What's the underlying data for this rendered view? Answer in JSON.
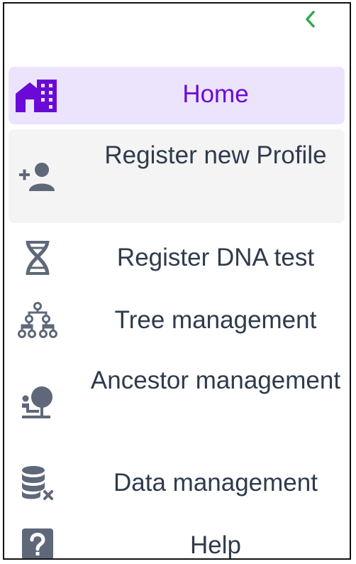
{
  "sidebar": {
    "collapse_icon": "chevron-left-icon",
    "colors": {
      "active_bg": "#ece3fc",
      "active_text": "#6a0ad6",
      "hover_bg": "#f4f4f4",
      "text": "#2f3b4c",
      "icon": "#5e6878",
      "chevron": "#2fa84f"
    },
    "items": [
      {
        "label": "Home",
        "icon": "home-building-icon",
        "state": "active"
      },
      {
        "label": "Register new Profile",
        "icon": "add-user-icon",
        "state": "hover"
      },
      {
        "label": "Register DNA test",
        "icon": "dna-icon"
      },
      {
        "label": "Tree management",
        "icon": "family-tree-icon"
      },
      {
        "label": "Ancestor management",
        "icon": "ancestor-icon"
      },
      {
        "label": "Data management",
        "icon": "database-delete-icon"
      },
      {
        "label": "Help",
        "icon": "help-icon"
      }
    ]
  }
}
